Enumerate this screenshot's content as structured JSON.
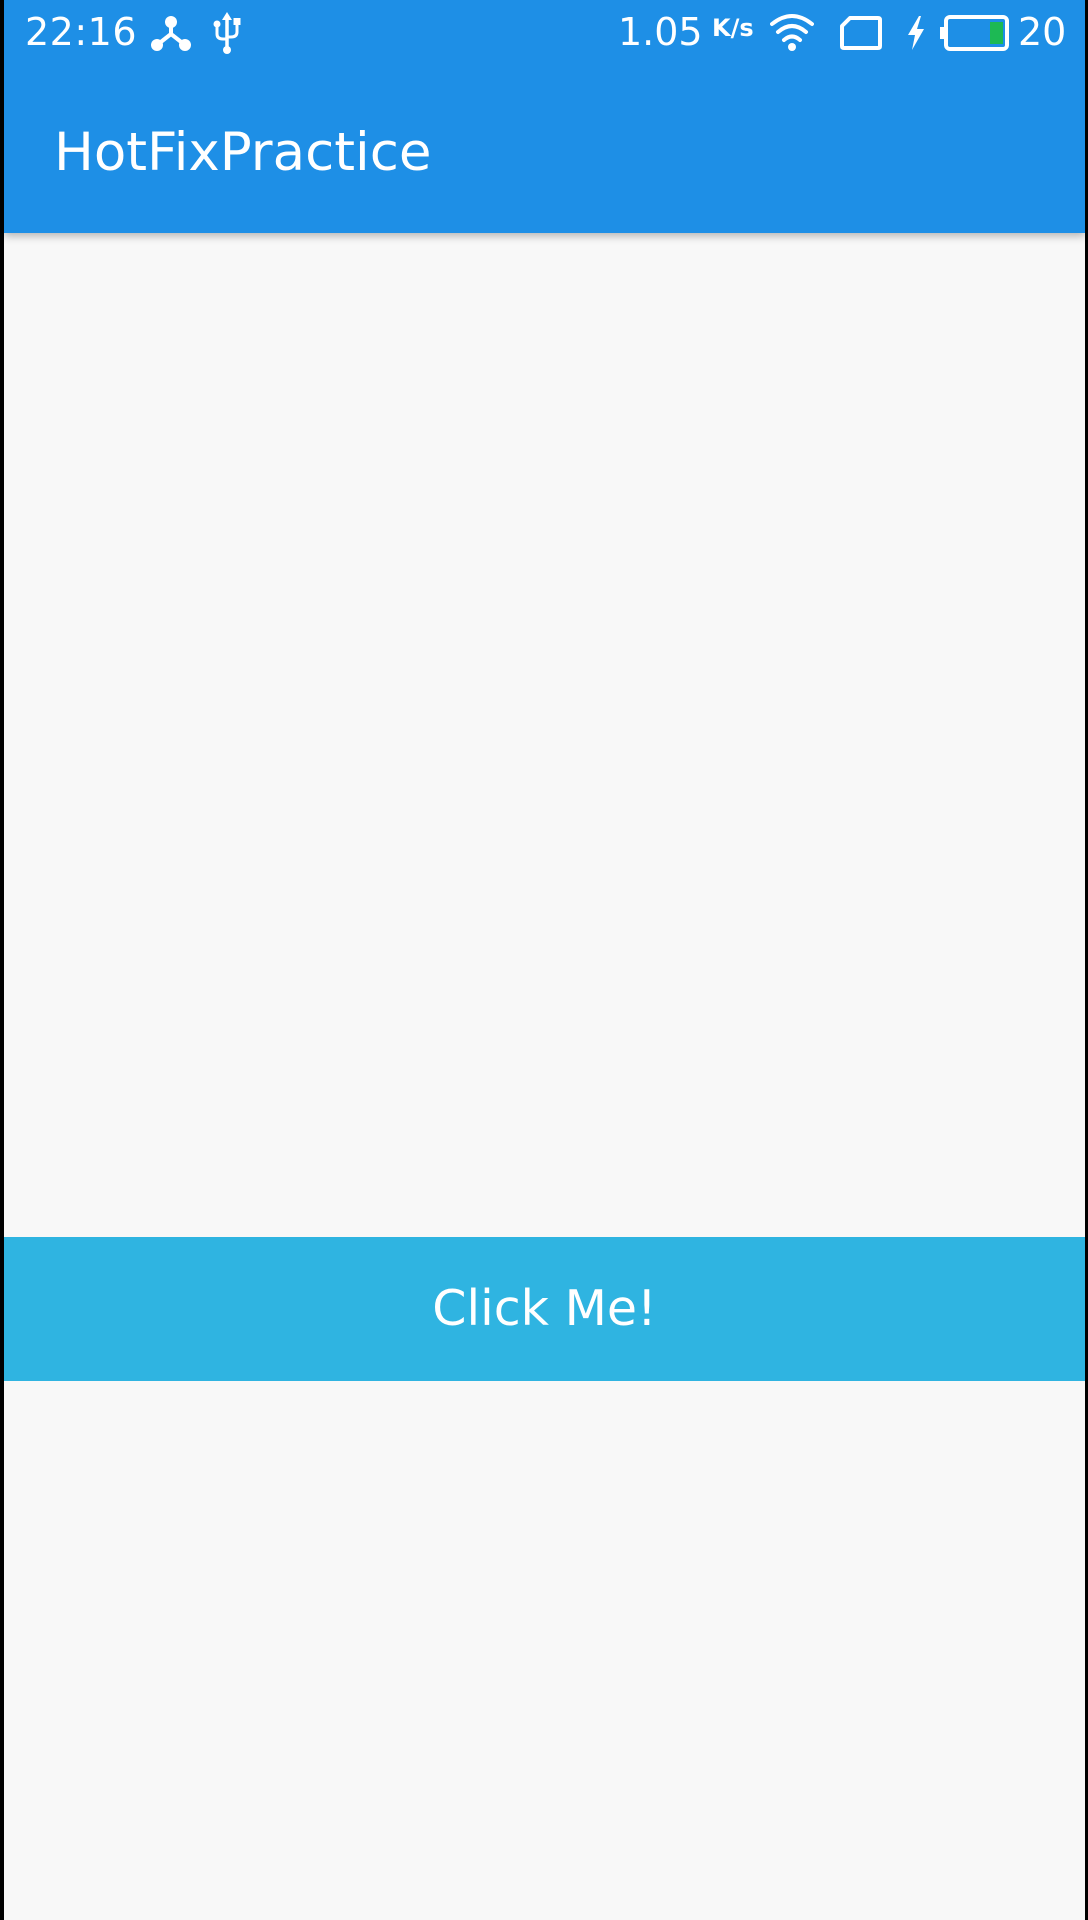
{
  "status_bar": {
    "time": "22:16",
    "network_speed": "1.05",
    "network_speed_unit": "K/s",
    "battery_percent": "20",
    "icons": [
      "usb-tether-icon",
      "usb-icon",
      "wifi-icon",
      "sim-card-icon",
      "charging-bolt-icon",
      "battery-icon"
    ],
    "battery_level_color": "#1db954"
  },
  "app_bar": {
    "title": "HotFixPractice",
    "color": "#1e8fe6"
  },
  "main": {
    "button_label": "Click Me!",
    "button_color": "#2fb4e1",
    "background_color": "#f8f8f8"
  }
}
